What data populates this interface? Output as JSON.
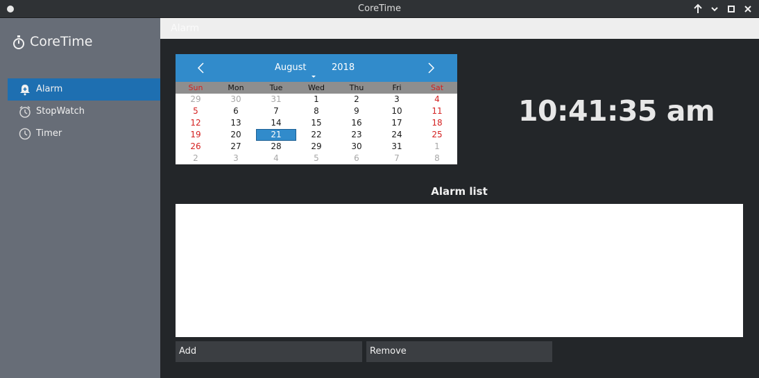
{
  "window": {
    "title": "CoreTime"
  },
  "sidebar": {
    "app_name": "CoreTime",
    "items": [
      {
        "label": "Alarm",
        "icon": "alarm-bell-icon",
        "active": true
      },
      {
        "label": "StopWatch",
        "icon": "stopwatch-icon",
        "active": false
      },
      {
        "label": "Timer",
        "icon": "clock-icon",
        "active": false
      }
    ]
  },
  "header": {
    "title": "Alarm"
  },
  "calendar": {
    "month": "August",
    "year": "2018",
    "weekdays": [
      "Sun",
      "Mon",
      "Tue",
      "Wed",
      "Thu",
      "Fri",
      "Sat"
    ],
    "weeks": [
      [
        "29",
        "30",
        "31",
        "1",
        "2",
        "3",
        "4"
      ],
      [
        "5",
        "6",
        "7",
        "8",
        "9",
        "10",
        "11"
      ],
      [
        "12",
        "13",
        "14",
        "15",
        "16",
        "17",
        "18"
      ],
      [
        "19",
        "20",
        "21",
        "22",
        "23",
        "24",
        "25"
      ],
      [
        "26",
        "27",
        "28",
        "29",
        "30",
        "31",
        "1"
      ],
      [
        "2",
        "3",
        "4",
        "5",
        "6",
        "7",
        "8"
      ]
    ],
    "selected_day": "21",
    "colors": {
      "header": "#318bcb",
      "weekend": "#d42020",
      "selected": "#318bcb"
    }
  },
  "clock": {
    "time": "10:41:35 am"
  },
  "alarm_list": {
    "title": "Alarm list",
    "items": []
  },
  "buttons": {
    "add": "Add",
    "remove": "Remove"
  },
  "colors": {
    "accent": "#1e6fb1",
    "sidebar": "#676d77",
    "background": "#232629"
  }
}
